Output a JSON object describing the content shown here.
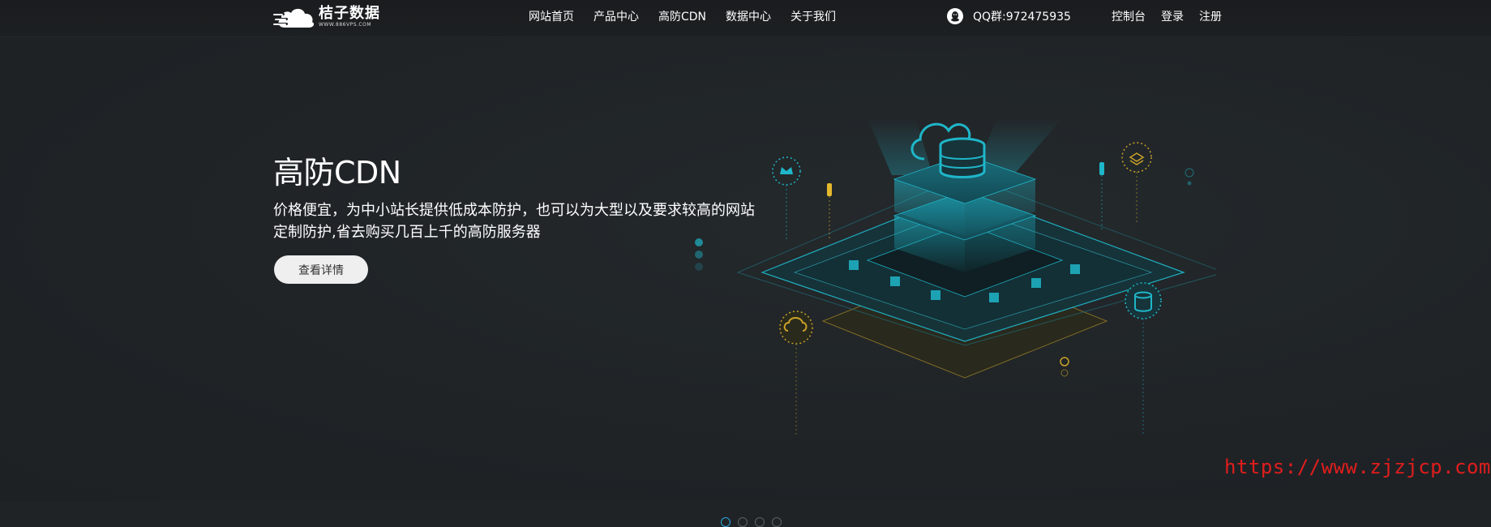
{
  "header": {
    "logo": {
      "title": "桔子数据",
      "subtitle": "WWW.886VPS.COM"
    },
    "nav": [
      {
        "label": "网站首页"
      },
      {
        "label": "产品中心"
      },
      {
        "label": "高防CDN"
      },
      {
        "label": "数据中心"
      },
      {
        "label": "关于我们"
      }
    ],
    "qq": {
      "icon": "qq-icon",
      "text": "QQ群:972475935"
    },
    "user_links": [
      {
        "label": "控制台"
      },
      {
        "label": "登录"
      },
      {
        "label": "注册"
      }
    ]
  },
  "hero": {
    "title": "高防CDN",
    "description": "价格便宜，为中小站长提供低成本防护，也可以为大型以及要求较高的网站定制防护,省去购买几百上千的高防服务器",
    "button_label": "查看详情",
    "slides": {
      "count": 4,
      "active_index": 0
    }
  },
  "watermark": {
    "text": "https://www.zjzjcp.com"
  },
  "colors": {
    "background": "#1f2326",
    "accent": "#2aa8e0",
    "teal": "#1fb6c9",
    "gold": "#c9a227",
    "watermark": "#e11d1d"
  }
}
